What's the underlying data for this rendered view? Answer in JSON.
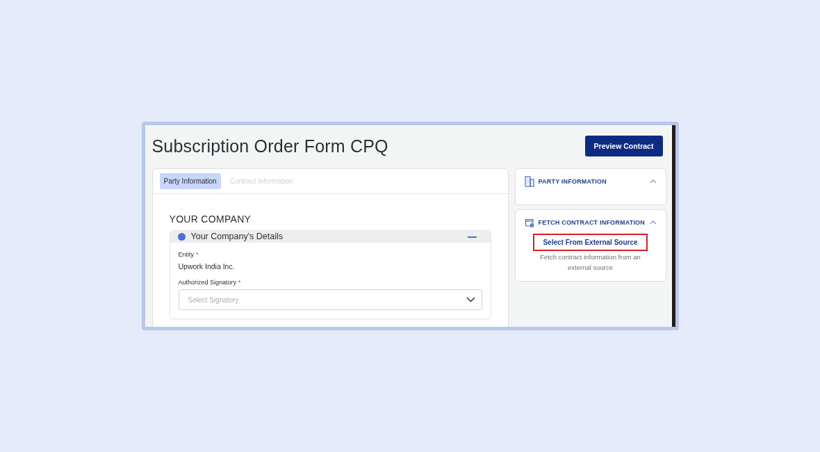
{
  "page": {
    "title": "Subscription Order Form CPQ",
    "primary_button": "Preview Contract"
  },
  "tabs": [
    {
      "label": "Party Information",
      "selected": true
    },
    {
      "label": "Contract Information",
      "selected": false
    }
  ],
  "section": {
    "heading": "YOUR COMPANY",
    "panel": {
      "title": "Your Company's Details",
      "expanded": true,
      "fields": [
        {
          "kind": "text",
          "label": "Entity",
          "required_mark": "*",
          "value": "Upwork India Inc."
        },
        {
          "kind": "select",
          "label": "Authorized Signatory",
          "required_mark": "*",
          "placeholder": "Select Signatory"
        }
      ]
    }
  },
  "side_panels": [
    {
      "kind": "party",
      "title": "PARTY INFORMATION",
      "expanded": true
    },
    {
      "kind": "fetch",
      "title": "FETCH CONTRACT INFORMATION",
      "expanded": true,
      "link": {
        "label": "Select From External Source",
        "highlighted": true
      },
      "description": "Fetch contract information from an external source"
    }
  ]
}
